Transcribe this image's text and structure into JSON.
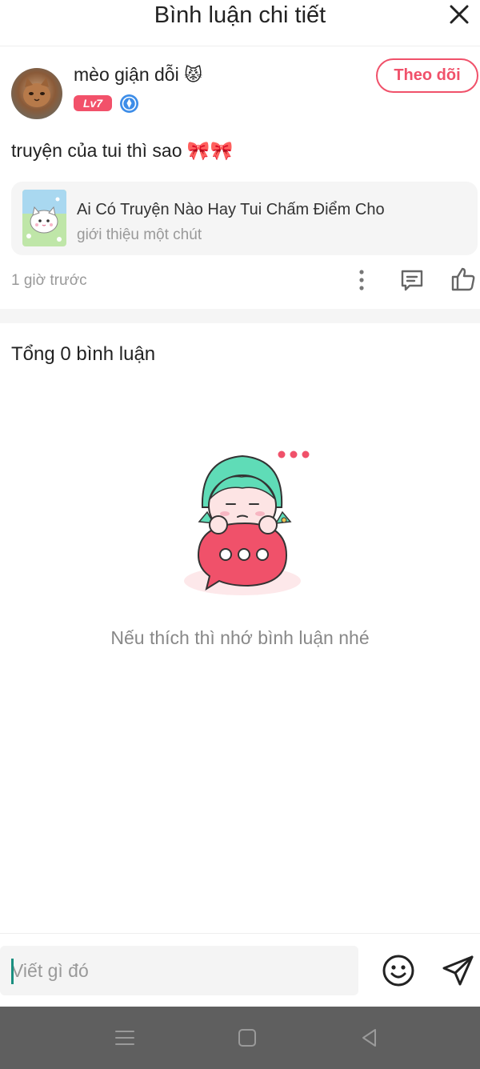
{
  "header": {
    "title": "Bình luận chi tiết"
  },
  "post": {
    "author": {
      "name": "mèo giận dỗi",
      "name_emoji": "😾",
      "level": "Lv7"
    },
    "follow_label": "Theo dõi",
    "content": "truyện của tui thì sao 🎀🎀",
    "linked_story": {
      "title": "Ai Có Truyện Nào Hay Tui Chấm Điểm Cho",
      "subtitle": "giới thiệu một chút"
    },
    "timestamp": "1 giờ trước"
  },
  "comments": {
    "count_label": "Tổng 0 bình luận",
    "empty_message": "Nếu thích thì nhớ bình luận nhé"
  },
  "input_bar": {
    "placeholder": "Viết gì đó"
  },
  "colors": {
    "accent": "#f0516a",
    "teal": "#5fdcb7",
    "nav_bar": "#5f5f5f"
  },
  "icons": {
    "close": "close-icon",
    "verified": "verified-badge-icon",
    "more": "more-vertical-icon",
    "comment": "comment-icon",
    "like": "thumbs-up-icon",
    "emoji": "emoji-icon",
    "send": "send-icon",
    "nav_menu": "menu-icon",
    "nav_home": "home-square-icon",
    "nav_back": "back-triangle-icon"
  }
}
